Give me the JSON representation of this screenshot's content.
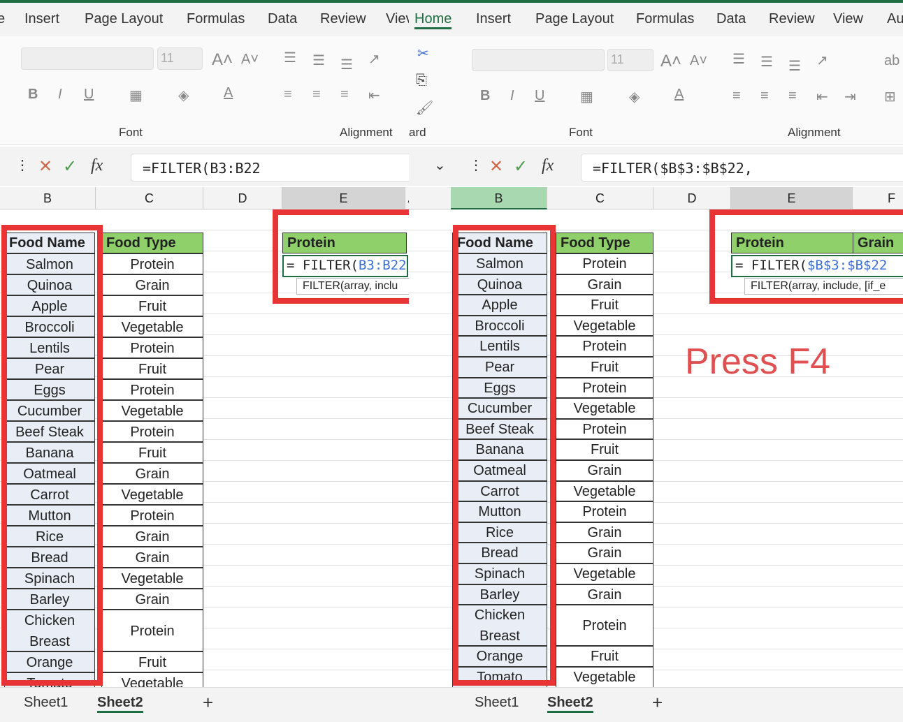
{
  "left": {
    "tabs": [
      "e",
      "Insert",
      "Page Layout",
      "Formulas",
      "Data",
      "Review",
      "Viev"
    ],
    "font_size": "11",
    "groups": {
      "font": "Font",
      "alignment": "Alignment"
    },
    "formula": "=FILTER(B3:B22",
    "columns": [
      "B",
      "C",
      "D",
      "E",
      "A"
    ],
    "header_name": "Food Name",
    "header_type": "Food Type",
    "e_header": "Protein",
    "cell_formula_prefix": "= FILTER(",
    "cell_formula_ref": "B3:B22",
    "hint": "FILTER(array, inclu",
    "hint_bold": "array",
    "sheets": [
      "Sheet1",
      "Sheet2"
    ]
  },
  "right": {
    "tabs": [
      "Home",
      "Insert",
      "Page Layout",
      "Formulas",
      "Data",
      "Review",
      "View",
      "Au"
    ],
    "clipboard_label": "ard",
    "font_size": "11",
    "groups": {
      "font": "Font",
      "alignment": "Alignment"
    },
    "formula": "=FILTER($B$3:$B$22,",
    "columns": [
      "B",
      "C",
      "D",
      "E",
      "F"
    ],
    "header_name": "Food Name",
    "header_type": "Food Type",
    "e_header": "Protein",
    "f_header": "Grain",
    "cell_formula_prefix": "= FILTER(",
    "cell_formula_ref": "$B$3:$B$22",
    "hint": "FILTER(array, include, [if_e",
    "sheets": [
      "Sheet1",
      "Sheet2"
    ],
    "annotation": "Press F4"
  },
  "foods": [
    {
      "name": "Salmon",
      "type": "Protein"
    },
    {
      "name": "Quinoa",
      "type": "Grain"
    },
    {
      "name": "Apple",
      "type": "Fruit"
    },
    {
      "name": "Broccoli",
      "type": "Vegetable"
    },
    {
      "name": "Lentils",
      "type": "Protein"
    },
    {
      "name": "Pear",
      "type": "Fruit"
    },
    {
      "name": "Eggs",
      "type": "Protein"
    },
    {
      "name": "Cucumber",
      "type": "Vegetable"
    },
    {
      "name": "Beef Steak",
      "type": "Protein"
    },
    {
      "name": "Banana",
      "type": "Fruit"
    },
    {
      "name": "Oatmeal",
      "type": "Grain"
    },
    {
      "name": "Carrot",
      "type": "Vegetable"
    },
    {
      "name": "Mutton",
      "type": "Protein"
    },
    {
      "name": "Rice",
      "type": "Grain"
    },
    {
      "name": "Bread",
      "type": "Grain"
    },
    {
      "name": "Spinach",
      "type": "Vegetable"
    },
    {
      "name": "Barley",
      "type": "Grain"
    },
    {
      "name": "Chicken Breast",
      "type": "Protein"
    },
    {
      "name": "Orange",
      "type": "Fruit"
    },
    {
      "name": "Tomato",
      "type": "Vegetable"
    }
  ],
  "colors": {
    "highlight": "#e83434",
    "header_fill": "#8fd06a",
    "accent": "#1f6e43"
  }
}
